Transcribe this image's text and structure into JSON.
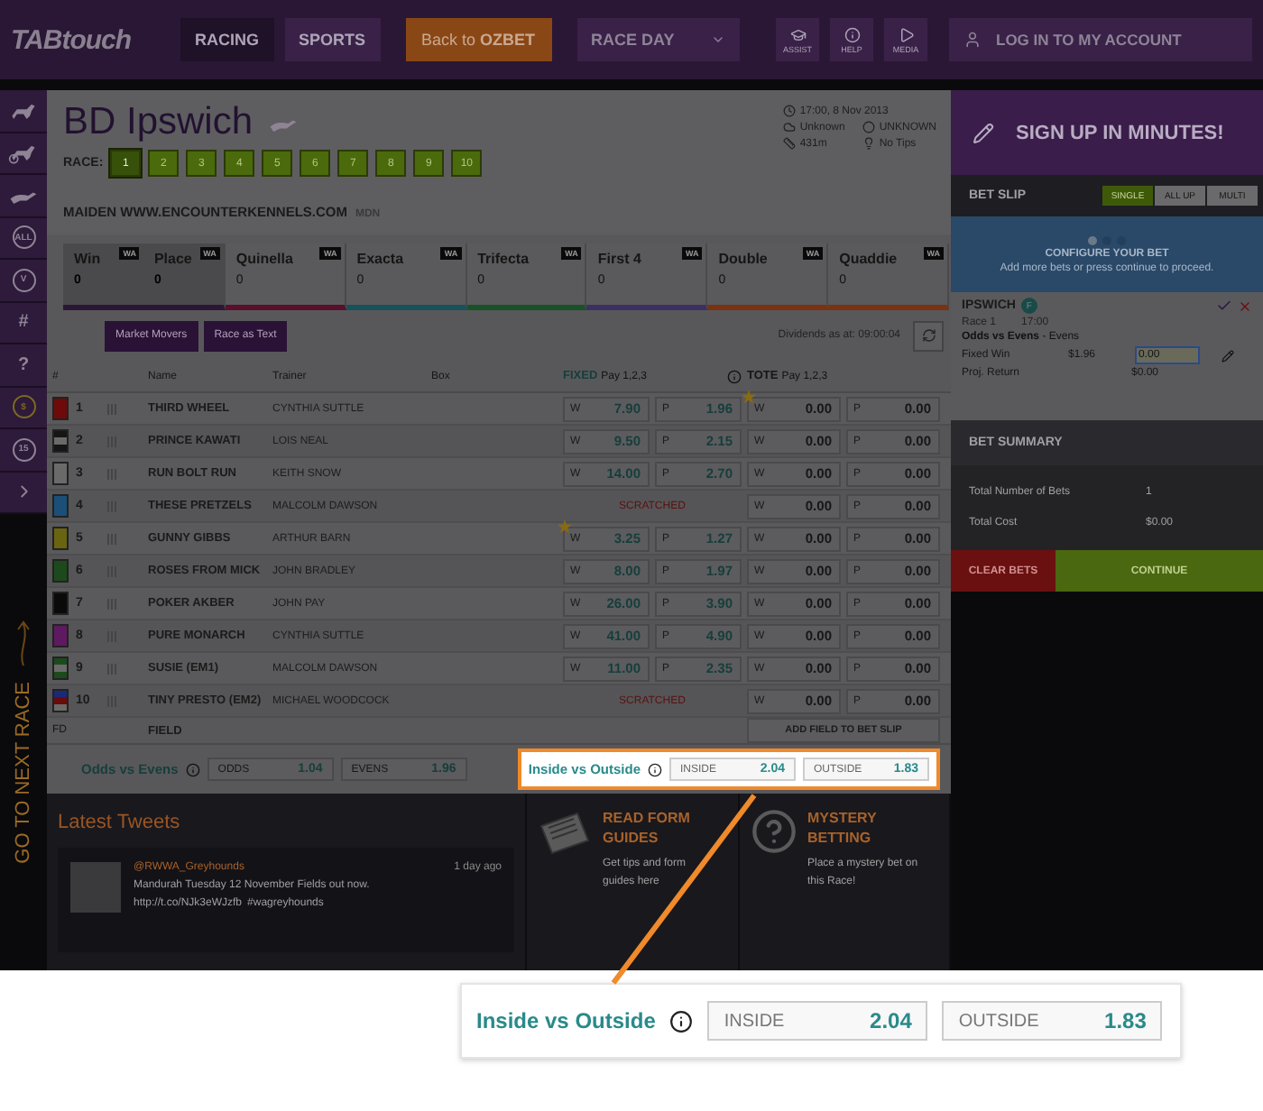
{
  "header": {
    "logo": "TABtouch",
    "nav": [
      {
        "label": "RACING",
        "selected": true
      },
      {
        "label": "SPORTS",
        "selected": false
      }
    ],
    "back_button": "Back to **OZBET**",
    "race_day": "RACE DAY",
    "tools": [
      {
        "kind": "assist",
        "label": "ASSIST"
      },
      {
        "kind": "help",
        "label": "HELP"
      },
      {
        "kind": "media",
        "label": "MEDIA"
      }
    ],
    "login": "LOG IN TO MY ACCOUNT"
  },
  "rail": {
    "items": [
      {
        "kind": "horse"
      },
      {
        "kind": "harness"
      },
      {
        "kind": "greyhound"
      },
      {
        "kind": "badge",
        "glyph": "ALL"
      },
      {
        "kind": "badge",
        "glyph": "V"
      },
      {
        "kind": "symbol",
        "glyph": "#"
      },
      {
        "kind": "symbol",
        "glyph": "?"
      },
      {
        "kind": "coin",
        "glyph": "$"
      },
      {
        "kind": "badge",
        "glyph": "15"
      },
      {
        "kind": "next"
      }
    ],
    "next_race": "GO TO NEXT RACE"
  },
  "race": {
    "title": "BD Ipswich",
    "race_label": "RACE:",
    "races": [
      {
        "label": "1",
        "selected": true
      },
      {
        "label": "2",
        "selected": false
      },
      {
        "label": "3",
        "selected": false
      },
      {
        "label": "4",
        "selected": false
      },
      {
        "label": "5",
        "selected": false
      },
      {
        "label": "6",
        "selected": false
      },
      {
        "label": "7",
        "selected": false
      },
      {
        "label": "8",
        "selected": false
      },
      {
        "label": "9",
        "selected": false
      },
      {
        "label": "10",
        "selected": false
      }
    ],
    "meta": [
      {
        "kind": "clock",
        "text": "17:00, 8 Nov 2013"
      },
      {
        "kind": "weather",
        "text": "Unknown"
      },
      {
        "kind": "track",
        "text": "UNKNOWN"
      },
      {
        "kind": "distance",
        "text": "431m"
      },
      {
        "kind": "tips",
        "text": "No Tips"
      }
    ],
    "name": "MAIDEN WWW.ENCOUNTERKENNELS.COM",
    "class": "MDN"
  },
  "bet_types": [
    {
      "selected": true,
      "color": "#2c1638",
      "parts": [
        {
          "name": "Win",
          "value": "0",
          "badge": "WA"
        },
        {
          "name": "Place",
          "value": "0",
          "badge": "WA"
        }
      ]
    },
    {
      "selected": false,
      "color": "#5a0f2c",
      "parts": [
        {
          "name": "Quinella",
          "value": "0",
          "badge": "WA"
        }
      ]
    },
    {
      "selected": false,
      "color": "#17525a",
      "parts": [
        {
          "name": "Exacta",
          "value": "0",
          "badge": "WA"
        }
      ]
    },
    {
      "selected": false,
      "color": "#1a5228",
      "parts": [
        {
          "name": "Trifecta",
          "value": "0",
          "badge": "WA"
        }
      ]
    },
    {
      "selected": false,
      "color": "#3e2f62",
      "parts": [
        {
          "name": "First 4",
          "value": "0",
          "badge": "WA"
        }
      ]
    },
    {
      "selected": false,
      "color": "#7a3210",
      "parts": [
        {
          "name": "Double",
          "value": "0",
          "badge": "WA"
        }
      ]
    },
    {
      "selected": false,
      "color": "#7a3210",
      "parts": [
        {
          "name": "Quaddie",
          "value": "0",
          "badge": "WA"
        }
      ]
    }
  ],
  "actions": [
    "Market Movers",
    "Race as Text"
  ],
  "dividends": "Dividends as at: 09:00:04",
  "table": {
    "columns": {
      "number": "#",
      "name": "Name",
      "trainer": "Trainer",
      "box": "Box",
      "fixed": "FIXED",
      "fixed_note": "Pay 1,2,3",
      "tote": "TOTE",
      "tote_note": "Pay 1,2,3"
    },
    "runners": [
      {
        "number": "1",
        "kind": "plain",
        "color": "#6e0a0a",
        "name": "THIRD WHEEL",
        "trainer": "CYNTHIA SUTTLE",
        "fixed_star": false,
        "tote_star": true,
        "fixed": [
          {
            "label": "W",
            "value": "7.90"
          },
          {
            "label": "P",
            "value": "1.96"
          }
        ],
        "tote": [
          {
            "label": "W",
            "value": "0.00"
          },
          {
            "label": "P",
            "value": "0.00"
          }
        ]
      },
      {
        "number": "2",
        "kind": "hoops",
        "color": "#151515",
        "name": "PRINCE KAWATI",
        "trainer": "LOIS NEAL",
        "fixed_star": false,
        "tote_star": false,
        "fixed": [
          {
            "label": "W",
            "value": "9.50"
          },
          {
            "label": "P",
            "value": "2.15"
          }
        ],
        "tote": [
          {
            "label": "W",
            "value": "0.00"
          },
          {
            "label": "P",
            "value": "0.00"
          }
        ]
      },
      {
        "number": "3",
        "kind": "plain",
        "color": "#6a6a6a",
        "name": "RUN BOLT RUN",
        "trainer": "KEITH SNOW",
        "fixed_star": false,
        "tote_star": false,
        "fixed": [
          {
            "label": "W",
            "value": "14.00"
          },
          {
            "label": "P",
            "value": "2.70"
          }
        ],
        "tote": [
          {
            "label": "W",
            "value": "0.00"
          },
          {
            "label": "P",
            "value": "0.00"
          }
        ]
      },
      {
        "number": "4",
        "kind": "plain",
        "color": "#1a4f78",
        "name": "THESE PRETZELS",
        "trainer": "MALCOLM DAWSON",
        "tote_star": false,
        "scratched": "SCRATCHED",
        "tote": [
          {
            "label": "W",
            "value": "0.00"
          },
          {
            "label": "P",
            "value": "0.00"
          }
        ]
      },
      {
        "number": "5",
        "kind": "plain",
        "color": "#6a6410",
        "name": "GUNNY GIBBS",
        "trainer": "ARTHUR BARN",
        "fixed_star": true,
        "tote_star": false,
        "fixed": [
          {
            "label": "W",
            "value": "3.25"
          },
          {
            "label": "P",
            "value": "1.27"
          }
        ],
        "tote": [
          {
            "label": "W",
            "value": "0.00"
          },
          {
            "label": "P",
            "value": "0.00"
          }
        ]
      },
      {
        "number": "6",
        "kind": "plain",
        "color": "#1d4a1d",
        "name": "ROSES FROM MICK",
        "trainer": "JOHN BRADLEY",
        "fixed_star": false,
        "tote_star": false,
        "fixed": [
          {
            "label": "W",
            "value": "8.00"
          },
          {
            "label": "P",
            "value": "1.97"
          }
        ],
        "tote": [
          {
            "label": "W",
            "value": "0.00"
          },
          {
            "label": "P",
            "value": "0.00"
          }
        ]
      },
      {
        "number": "7",
        "kind": "plain",
        "color": "#0a0a0a",
        "name": "POKER AKBER",
        "trainer": "JOHN PAY",
        "fixed_star": false,
        "tote_star": false,
        "fixed": [
          {
            "label": "W",
            "value": "26.00"
          },
          {
            "label": "P",
            "value": "3.90"
          }
        ],
        "tote": [
          {
            "label": "W",
            "value": "0.00"
          },
          {
            "label": "P",
            "value": "0.00"
          }
        ]
      },
      {
        "number": "8",
        "kind": "plain",
        "color": "#5e1a60",
        "name": "PURE MONARCH",
        "trainer": "CYNTHIA SUTTLE",
        "fixed_star": false,
        "tote_star": false,
        "fixed": [
          {
            "label": "W",
            "value": "41.00"
          },
          {
            "label": "P",
            "value": "4.90"
          }
        ],
        "tote": [
          {
            "label": "W",
            "value": "0.00"
          },
          {
            "label": "P",
            "value": "0.00"
          }
        ]
      },
      {
        "number": "9",
        "kind": "hoops",
        "color": "#1d4a1d",
        "name": "SUSIE (EM1)",
        "trainer": "MALCOLM DAWSON",
        "fixed_star": false,
        "tote_star": false,
        "fixed": [
          {
            "label": "W",
            "value": "11.00"
          },
          {
            "label": "P",
            "value": "2.35"
          }
        ],
        "tote": [
          {
            "label": "W",
            "value": "0.00"
          },
          {
            "label": "P",
            "value": "0.00"
          }
        ]
      },
      {
        "number": "10",
        "kind": "tricolor",
        "color": "#1a2a78",
        "name": "TINY PRESTO (EM2)",
        "trainer": "MICHAEL WOODCOCK",
        "tote_star": false,
        "scratched": "SCRATCHED",
        "tote": [
          {
            "label": "W",
            "value": "0.00"
          },
          {
            "label": "P",
            "value": "0.00"
          }
        ]
      }
    ],
    "field": {
      "number": "FD",
      "name": "FIELD",
      "button": "ADD FIELD TO BET SLIP"
    }
  },
  "exotics": [
    {
      "title": "Odds vs Evens",
      "highlighted": false,
      "options": [
        {
          "label": "ODDS",
          "value": "1.04"
        },
        {
          "label": "EVENS",
          "value": "1.96"
        }
      ]
    },
    {
      "title": "Inside vs Outside",
      "highlighted": true,
      "options": [
        {
          "label": "INSIDE",
          "value": "2.04"
        },
        {
          "label": "OUTSIDE",
          "value": "1.83"
        }
      ]
    }
  ],
  "tweets": {
    "heading": "Latest Tweets",
    "handle": "@RWWA_Greyhounds",
    "time": "1 day ago",
    "text": "Mandurah Tuesday 12 November Fields out now.",
    "link": "http://t.co/NJk3eWJzfb",
    "tag": "#wagreyhounds"
  },
  "promos": [
    {
      "kind": "form",
      "title": "READ FORM GUIDES",
      "text": "Get tips and form guides here"
    },
    {
      "kind": "mystery",
      "title": "MYSTERY BETTING",
      "text": "Place a mystery bet on this Race!"
    }
  ],
  "bet_slip": {
    "signup": "SIGN UP IN MINUTES!",
    "title": "BET SLIP",
    "modes": [
      {
        "label": "SINGLE",
        "selected": true
      },
      {
        "label": "ALL UP",
        "selected": false
      },
      {
        "label": "MULTI",
        "selected": false
      }
    ],
    "steps": [
      {
        "selected": true
      },
      {
        "selected": false
      },
      {
        "selected": false
      }
    ],
    "configure_title": "CONFIGURE YOUR BET",
    "configure_text": "Add more bets or press continue to proceed.",
    "bet": {
      "venue": "IPSWICH",
      "badge": "F",
      "race": "Race 1",
      "time": "17:00",
      "selection": "**Odds vs Evens** - Evens",
      "fixed_label": "Fixed Win",
      "fixed_value": "$1.96",
      "stake": "0.00",
      "return_label": "Proj. Return",
      "return_value": "$0.00"
    },
    "summary_title": "BET SUMMARY",
    "summary": [
      {
        "label": "Total Number of Bets",
        "value": "1"
      },
      {
        "label": "Total Cost",
        "value": "$0.00"
      }
    ],
    "clear": "CLEAR BETS",
    "continue": "CONTINUE"
  },
  "callout": {
    "title": "Inside vs Outside",
    "options": [
      {
        "label": "INSIDE",
        "value": "2.04"
      },
      {
        "label": "OUTSIDE",
        "value": "1.83"
      }
    ]
  }
}
